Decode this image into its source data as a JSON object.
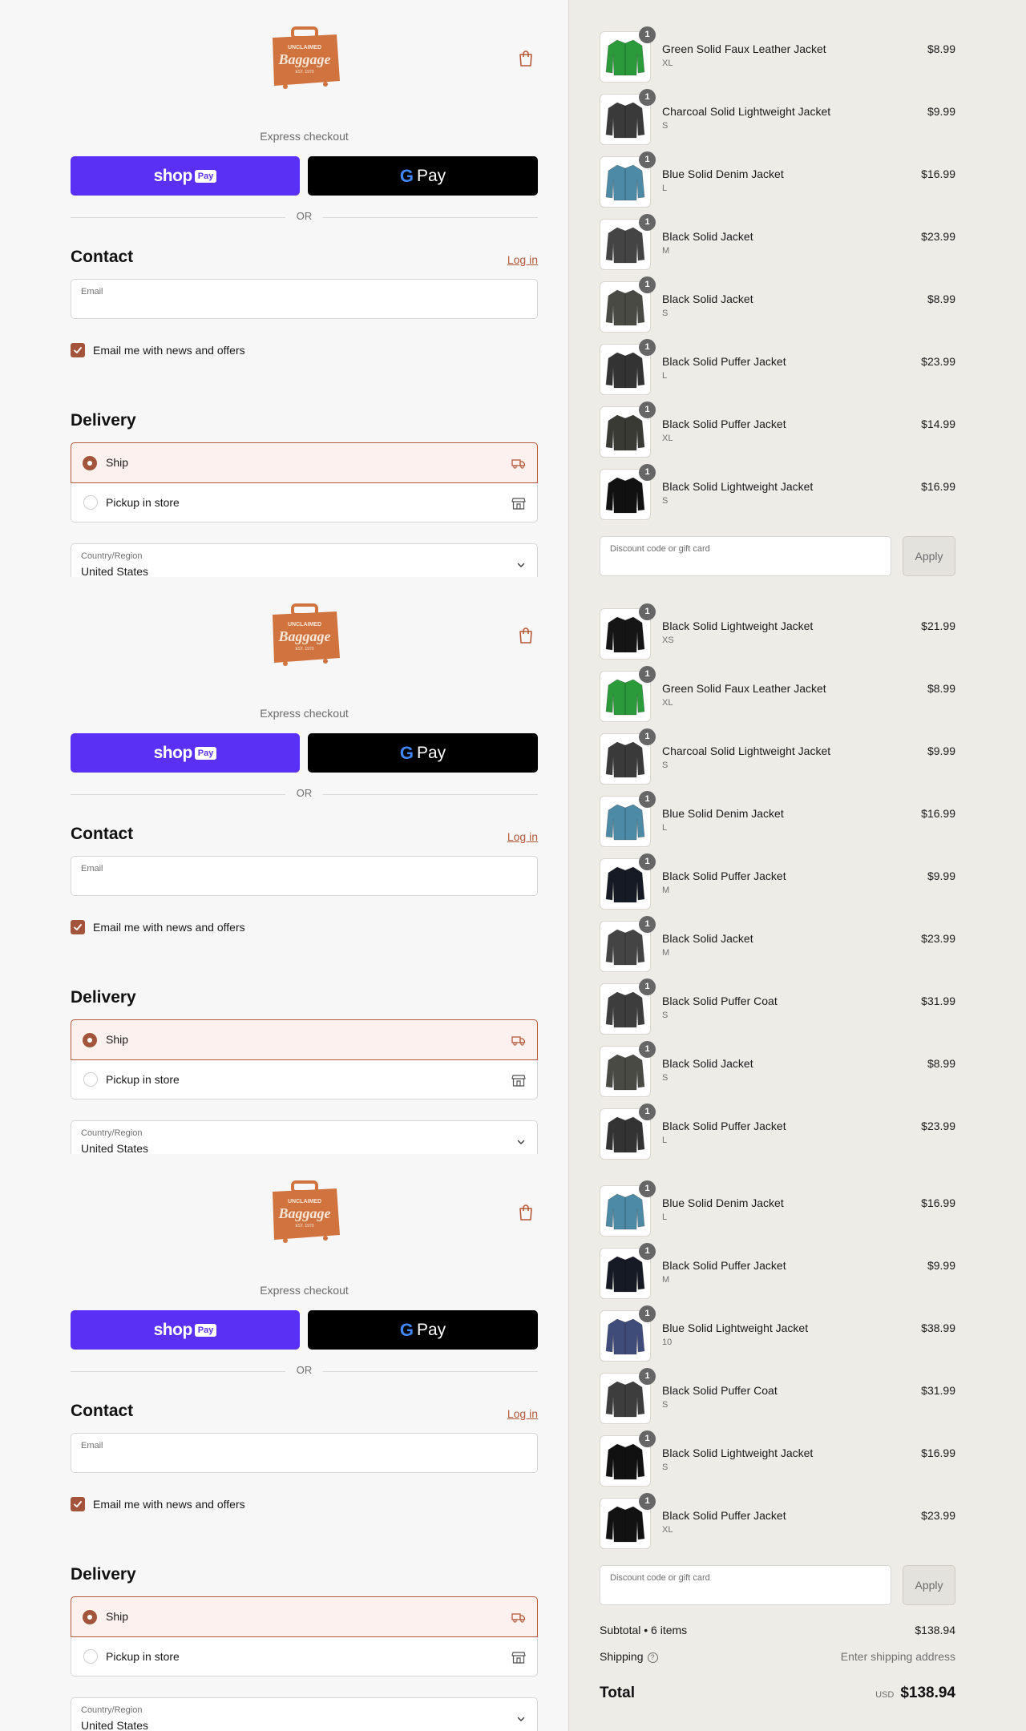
{
  "brand": {
    "logo_top": "UNCLAIMED",
    "logo_main": "Baggage",
    "logo_bottom": "EST. 1970",
    "accent": "#b4593b",
    "shop_pay_color": "#5a31f4"
  },
  "checkout": {
    "express_label": "Express checkout",
    "shop_pay_word": "shop",
    "shop_pay_badge": "Pay",
    "gpay_letter": "G",
    "gpay_word": "Pay",
    "or_text": "OR",
    "contact_heading": "Contact",
    "login_link": "Log in",
    "email_label": "Email",
    "newsletter_label": "Email me with news and offers",
    "newsletter_checked": true,
    "delivery_heading": "Delivery",
    "ship_label": "Ship",
    "pickup_label": "Pickup in store",
    "selected_delivery": "Ship",
    "country_label": "Country/Region",
    "country_value": "United States"
  },
  "summary_block_1": {
    "products": [
      {
        "name": "Green Solid Faux Leather Jacket",
        "size": "XL",
        "price": "$8.99",
        "qty": "1",
        "color": "#2a9a3a"
      },
      {
        "name": "Charcoal Solid Lightweight Jacket",
        "size": "S",
        "price": "$9.99",
        "qty": "1",
        "color": "#3a3a3a"
      },
      {
        "name": "Blue Solid Denim Jacket",
        "size": "L",
        "price": "$16.99",
        "qty": "1",
        "color": "#4d8aa6"
      },
      {
        "name": "Black Solid Jacket",
        "size": "M",
        "price": "$23.99",
        "qty": "1",
        "color": "#444444"
      },
      {
        "name": "Black Solid Jacket",
        "size": "S",
        "price": "$8.99",
        "qty": "1",
        "color": "#4a4a44"
      },
      {
        "name": "Black Solid Puffer Jacket",
        "size": "L",
        "price": "$23.99",
        "qty": "1",
        "color": "#333333"
      },
      {
        "name": "Black Solid Puffer Jacket",
        "size": "XL",
        "price": "$14.99",
        "qty": "1",
        "color": "#3a3a34"
      },
      {
        "name": "Black Solid Lightweight Jacket",
        "size": "S",
        "price": "$16.99",
        "qty": "1",
        "color": "#111111"
      }
    ],
    "discount_label": "Discount code or gift card",
    "apply_label": "Apply"
  },
  "summary_block_2": {
    "products": [
      {
        "name": "Black Solid Lightweight Jacket",
        "size": "XS",
        "price": "$21.99",
        "qty": "1",
        "color": "#151515"
      },
      {
        "name": "Green Solid Faux Leather Jacket",
        "size": "XL",
        "price": "$8.99",
        "qty": "1",
        "color": "#2a9a3a"
      },
      {
        "name": "Charcoal Solid Lightweight Jacket",
        "size": "S",
        "price": "$9.99",
        "qty": "1",
        "color": "#3a3a3a"
      },
      {
        "name": "Blue Solid Denim Jacket",
        "size": "L",
        "price": "$16.99",
        "qty": "1",
        "color": "#4d8aa6"
      },
      {
        "name": "Black Solid Puffer Jacket",
        "size": "M",
        "price": "$9.99",
        "qty": "1",
        "color": "#161a24"
      },
      {
        "name": "Black Solid Jacket",
        "size": "M",
        "price": "$23.99",
        "qty": "1",
        "color": "#444444"
      },
      {
        "name": "Black Solid Puffer Coat",
        "size": "S",
        "price": "$31.99",
        "qty": "1",
        "color": "#3d3d3d"
      },
      {
        "name": "Black Solid Jacket",
        "size": "S",
        "price": "$8.99",
        "qty": "1",
        "color": "#4a4a44"
      },
      {
        "name": "Black Solid Puffer Jacket",
        "size": "L",
        "price": "$23.99",
        "qty": "1",
        "color": "#333333"
      }
    ]
  },
  "summary_block_3": {
    "products": [
      {
        "name": "Blue Solid Denim Jacket",
        "size": "L",
        "price": "$16.99",
        "qty": "1",
        "color": "#4d8aa6"
      },
      {
        "name": "Black Solid Puffer Jacket",
        "size": "M",
        "price": "$9.99",
        "qty": "1",
        "color": "#161a24"
      },
      {
        "name": "Blue Solid Lightweight Jacket",
        "size": "10",
        "price": "$38.99",
        "qty": "1",
        "color": "#3f4c7a"
      },
      {
        "name": "Black Solid Puffer Coat",
        "size": "S",
        "price": "$31.99",
        "qty": "1",
        "color": "#3d3d3d"
      },
      {
        "name": "Black Solid Lightweight Jacket",
        "size": "S",
        "price": "$16.99",
        "qty": "1",
        "color": "#111111"
      },
      {
        "name": "Black Solid Puffer Jacket",
        "size": "XL",
        "price": "$23.99",
        "qty": "1",
        "color": "#121212"
      }
    ],
    "discount_label": "Discount code or gift card",
    "apply_label": "Apply"
  },
  "totals": {
    "subtotal_label": "Subtotal • 6 items",
    "subtotal_value": "$138.94",
    "shipping_label": "Shipping",
    "shipping_help": "?",
    "shipping_value": "Enter shipping address",
    "total_label": "Total",
    "total_currency": "USD",
    "total_value": "$138.94"
  }
}
